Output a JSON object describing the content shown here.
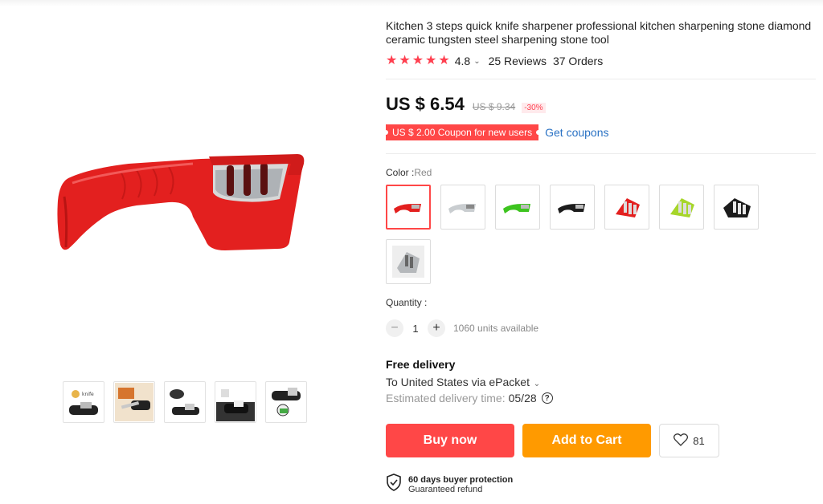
{
  "product": {
    "title": "Kitchen 3 steps quick knife sharpener professional kitchen sharpening stone diamond ceramic tungsten steel sharpening stone tool",
    "rating": "4.8",
    "reviews": "25 Reviews",
    "orders": "37 Orders",
    "price": "US $ 6.54",
    "original_price": "US $ 9.34",
    "discount": "-30%",
    "coupon": "US $ 2.00 Coupon for new users",
    "get_coupons": "Get coupons"
  },
  "color": {
    "label": "Color :",
    "selected": "Red",
    "options": [
      "Red",
      "Gray",
      "Green",
      "Black",
      "Red",
      "Lime",
      "Black",
      "Silver"
    ]
  },
  "quantity": {
    "label": "Quantity :",
    "value": "1",
    "available": "1060 units available"
  },
  "delivery": {
    "title": "Free delivery",
    "to": "To United States via ePacket",
    "estimated_label": "Estimated delivery time:",
    "estimated_date": "05/28"
  },
  "actions": {
    "buy_now": "Buy now",
    "add_to_cart": "Add to Cart",
    "wishlist_count": "81"
  },
  "protection": {
    "title": "60 days buyer protection",
    "subtitle": "Guaranteed refund"
  },
  "colors": {
    "accent_red": "#ff4747",
    "cart_orange": "#ff9a00",
    "link_blue": "#2a72c4",
    "star_red": "#ff3f4f"
  }
}
